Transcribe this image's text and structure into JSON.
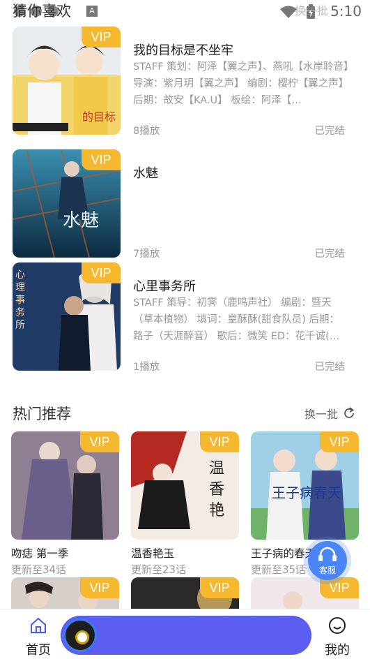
{
  "status_bar": {
    "time": "5:10"
  },
  "guess": {
    "title": "猜你喜欢",
    "swap_label": "换一批",
    "items": [
      {
        "vip": "VIP",
        "title": "我的目标是不坐牢",
        "desc": "STAFF 策划：阿泽【翼之声】、燕吼【水岸聆音】导演：紫月玥【翼之声】 编剧：樱柠【翼之声】 后期：故安【KA.U】 板绘：阿泽【…",
        "plays": "8播放",
        "status": "已完结"
      },
      {
        "vip": "VIP",
        "title": "水魅",
        "desc": "",
        "plays": "7播放",
        "status": "已完结"
      },
      {
        "vip": "VIP",
        "title": "心里事务所",
        "desc": "STAFF 策导：初霁（鹿鸣声社） 编剧：暨天（草本植物） 填词：皇酥酥(甜食队员) 后期：路子（天涯醉音） 歌后：微笑 ED：花千诚(…",
        "plays": "1播放",
        "status": "已完结"
      }
    ]
  },
  "hot": {
    "title": "热门推荐",
    "swap_label": "换一批",
    "cards": [
      {
        "vip": "VIP",
        "name": "吻痣 第一季",
        "update": "更新至34话"
      },
      {
        "vip": "VIP",
        "name": "温香艳玉",
        "update": "更新至23话"
      },
      {
        "vip": "VIP",
        "name": "王子病的春天",
        "update": "更新至35话"
      },
      {
        "vip": "VIP"
      },
      {
        "vip": "VIP"
      },
      {
        "vip": "VIP"
      }
    ]
  },
  "service": {
    "label": "客服"
  },
  "bottom_nav": {
    "home_label": "首页",
    "mine_label": "我的"
  },
  "colors": {
    "vip": "#f5b82e",
    "accent": "#4a86f7",
    "player": "#5b5ef0"
  }
}
